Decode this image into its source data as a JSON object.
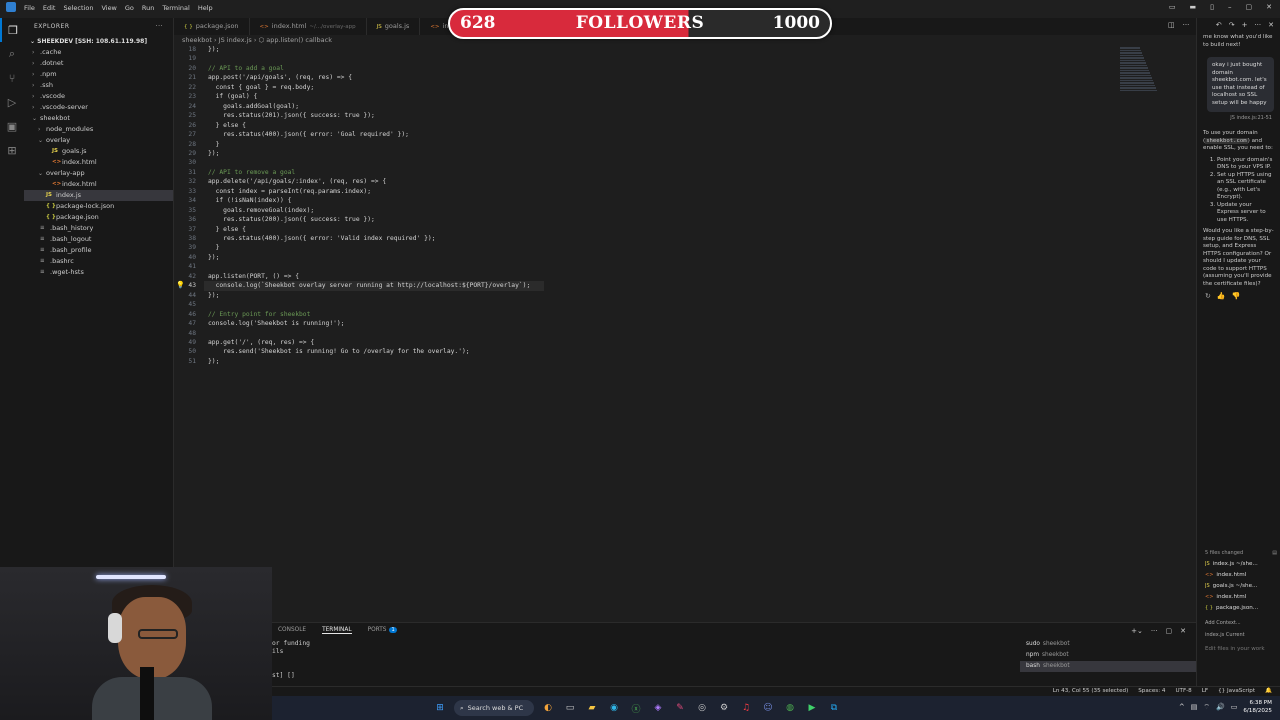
{
  "menu": [
    "File",
    "Edit",
    "Selection",
    "View",
    "Go",
    "Run",
    "Terminal",
    "Help"
  ],
  "sidebar": {
    "title": "EXPLORER",
    "root": "SHEEKDEV [SSH: 108.61.119.98]",
    "items": [
      {
        "label": ".cache",
        "depth": 1,
        "kind": "folder"
      },
      {
        "label": ".dotnet",
        "depth": 1,
        "kind": "folder"
      },
      {
        "label": ".npm",
        "depth": 1,
        "kind": "folder"
      },
      {
        "label": ".ssh",
        "depth": 1,
        "kind": "folder"
      },
      {
        "label": ".vscode",
        "depth": 1,
        "kind": "folder"
      },
      {
        "label": ".vscode-server",
        "depth": 1,
        "kind": "folder"
      },
      {
        "label": "sheekbot",
        "depth": 1,
        "kind": "folder-open"
      },
      {
        "label": "node_modules",
        "depth": 2,
        "kind": "folder"
      },
      {
        "label": "overlay",
        "depth": 2,
        "kind": "folder-open"
      },
      {
        "label": "goals.js",
        "depth": 3,
        "kind": "js"
      },
      {
        "label": "index.html",
        "depth": 3,
        "kind": "html"
      },
      {
        "label": "overlay-app",
        "depth": 2,
        "kind": "folder-open"
      },
      {
        "label": "index.html",
        "depth": 3,
        "kind": "html"
      },
      {
        "label": "index.js",
        "depth": 2,
        "kind": "js",
        "selected": true
      },
      {
        "label": "package-lock.json",
        "depth": 2,
        "kind": "json"
      },
      {
        "label": "package.json",
        "depth": 2,
        "kind": "json"
      },
      {
        "label": ".bash_history",
        "depth": 1,
        "kind": "file"
      },
      {
        "label": ".bash_logout",
        "depth": 1,
        "kind": "file"
      },
      {
        "label": ".bash_profile",
        "depth": 1,
        "kind": "file"
      },
      {
        "label": ".bashrc",
        "depth": 1,
        "kind": "file"
      },
      {
        "label": ".wget-hsts",
        "depth": 1,
        "kind": "file"
      }
    ]
  },
  "tabs": [
    {
      "label": "package.json",
      "dim": "",
      "icon": "{ }"
    },
    {
      "label": "index.html",
      "dim": "~/.../overlay-app",
      "icon": "<>"
    },
    {
      "label": "goals.js",
      "dim": "",
      "icon": "JS"
    },
    {
      "label": "index.h",
      "dim": "",
      "icon": "<>"
    }
  ],
  "breadcrumb": "sheekbot  ›  JS index.js  ›  ⬡ app.listen() callback",
  "code": [
    {
      "n": "18",
      "t": "});"
    },
    {
      "n": "19",
      "t": ""
    },
    {
      "n": "20",
      "t": "// API to add a goal"
    },
    {
      "n": "21",
      "t": "app.post('/api/goals', (req, res) => {"
    },
    {
      "n": "22",
      "t": "  const { goal } = req.body;"
    },
    {
      "n": "23",
      "t": "  if (goal) {"
    },
    {
      "n": "24",
      "t": "    goals.addGoal(goal);"
    },
    {
      "n": "25",
      "t": "    res.status(201).json({ success: true });"
    },
    {
      "n": "26",
      "t": "  } else {"
    },
    {
      "n": "27",
      "t": "    res.status(400).json({ error: 'Goal required' });"
    },
    {
      "n": "28",
      "t": "  }"
    },
    {
      "n": "29",
      "t": "});"
    },
    {
      "n": "30",
      "t": ""
    },
    {
      "n": "31",
      "t": "// API to remove a goal"
    },
    {
      "n": "32",
      "t": "app.delete('/api/goals/:index', (req, res) => {"
    },
    {
      "n": "33",
      "t": "  const index = parseInt(req.params.index);"
    },
    {
      "n": "34",
      "t": "  if (!isNaN(index)) {"
    },
    {
      "n": "35",
      "t": "    goals.removeGoal(index);"
    },
    {
      "n": "36",
      "t": "    res.status(200).json({ success: true });"
    },
    {
      "n": "37",
      "t": "  } else {"
    },
    {
      "n": "38",
      "t": "    res.status(400).json({ error: 'Valid index required' });"
    },
    {
      "n": "39",
      "t": "  }"
    },
    {
      "n": "40",
      "t": "});"
    },
    {
      "n": "41",
      "t": ""
    },
    {
      "n": "42",
      "t": "app.listen(PORT, () => {"
    },
    {
      "n": "43",
      "t": "  console.log(`Sheekbot overlay server running at http://localhost:${PORT}/overlay`);"
    },
    {
      "n": "44",
      "t": "});"
    },
    {
      "n": "45",
      "t": ""
    },
    {
      "n": "46",
      "t": "// Entry point for sheekbot"
    },
    {
      "n": "47",
      "t": "console.log('Sheekbot is running!');"
    },
    {
      "n": "48",
      "t": ""
    },
    {
      "n": "49",
      "t": "app.get('/', (req, res) => {"
    },
    {
      "n": "50",
      "t": "    res.send('Sheekbot is running! Go to /overlay for the overlay.');"
    },
    {
      "n": "51",
      "t": "});"
    }
  ],
  "current_line": "43",
  "overlay": {
    "current": "628",
    "label": "FOLLOWERS",
    "goal": "1000",
    "progress": 0.628,
    "fill_color": "#d82a3c"
  },
  "chat": {
    "intro": "me know what you'd like to build next!",
    "user_message": "okay i just bought domain sheekbot.com. let's use that instead of localhost so SSL setup will be happy",
    "user_ref": "index.js:21-51",
    "reply_pre": "To use your domain (",
    "reply_domain": "sheekbot.com",
    "reply_post": ") and enable SSL, you need to:",
    "steps": [
      "Point your domain's DNS to your VPS IP.",
      "Set up HTTPS using an SSL certificate (e.g., with Let's Encrypt).",
      "Update your Express server to use HTTPS."
    ],
    "followup": "Would you like a step-by-step guide for DNS, SSL setup, and Express HTTPS configuration? Or should I update your code to support HTTPS (assuming you'll provide the certificate files)?",
    "files_changed": "5 files changed",
    "changed_files": [
      {
        "icon": "JS",
        "label": "index.js ~/she..."
      },
      {
        "icon": "<>",
        "label": "index.html"
      },
      {
        "icon": "JS",
        "label": "goals.js ~/she..."
      },
      {
        "icon": "<>",
        "label": "index.html"
      },
      {
        "icon": "{ }",
        "label": "package.json..."
      }
    ],
    "add_context": "Add Context...",
    "context_chip": "index.js Current",
    "input_placeholder": "Edit files in your work"
  },
  "terminal": {
    "tabs": [
      "CONSOLE",
      "TERMINAL",
      "PORTS"
    ],
    "ports_badge": "1",
    "lines": [
      "or funding",
      "ils",
      "",
      "",
      "st] []"
    ],
    "instances": [
      {
        "name": "sudo",
        "dir": "sheekbot"
      },
      {
        "name": "npm",
        "dir": "sheekbot"
      },
      {
        "name": "bash",
        "dir": "sheekbot"
      }
    ]
  },
  "status": {
    "position": "Ln 43, Col 55 (35 selected)",
    "spaces": "Spaces: 4",
    "encoding": "UTF-8",
    "eol": "LF",
    "language": "{} JavaScript"
  },
  "taskbar": {
    "search": "Search web & PC",
    "time": "6:38 PM",
    "date": "6/18/2025"
  }
}
